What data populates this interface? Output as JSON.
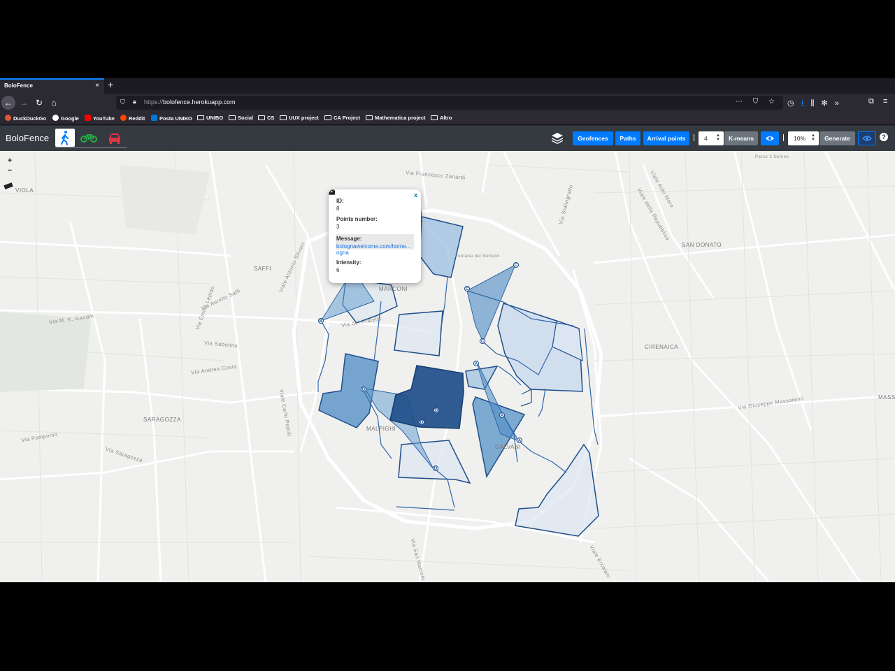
{
  "browser": {
    "tab_title": "BoloFence",
    "tab_close": "×",
    "new_tab": "+",
    "url_scheme": "https://",
    "url_host": "bolofence.herokuapp.com",
    "bookmarks": [
      "DuckDuckGo",
      "Google",
      "YouTube",
      "Reddit",
      "Posta UNIBO",
      "UNIBO",
      "Social",
      "CS",
      "UUX project",
      "CA Project",
      "Mathematica project",
      "Altro"
    ]
  },
  "app": {
    "brand": "BoloFence",
    "modes": [
      "walk-icon",
      "bike-icon",
      "car-icon"
    ],
    "buttons": {
      "geofences": "Geofences",
      "paths": "Paths",
      "arrival_points": "Arrival points",
      "kmeans": "K-means",
      "generate": "Generate",
      "help": "?"
    },
    "k_value": "4",
    "percent_value": "10%"
  },
  "map": {
    "zoom_in": "+",
    "zoom_out": "−",
    "labels": [
      "VIOLA",
      "SAFFI",
      "MARCONI",
      "SAN DONATO",
      "CIRENAICA",
      "SARAGOZZA",
      "MALPIGHI",
      "GALVANI",
      "MASS",
      "Via Andrea Costa",
      "Via Saragozza",
      "Via Sabotino",
      "Viale Carlo Pepoli",
      "Via Emilio Lepido",
      "Via Aurelio Saffi",
      "Via M. K. Gandhi",
      "Via Giuseppe Massarenti",
      "Via Pomponio",
      "Viale Antonio Silvani",
      "Parco 2 Donino",
      "Via San Mamolo",
      "Viale Ercolani",
      "Via Stalingrado",
      "Viale della Repubblica",
      "Via del Pratello",
      "Fontana dei Nettuno",
      "Viale Aldo Moro",
      "Via Francesco Zanardi"
    ],
    "colors": {
      "fence_dark": "#1f4e8a",
      "fence_mid": "#4c8bc4",
      "fence_light": "#c9daee",
      "path": "#2f66a8"
    },
    "markers": [
      "B",
      "C",
      "C",
      "C",
      "D",
      "D",
      "D",
      "D",
      "A",
      "A",
      "A"
    ]
  },
  "popup": {
    "close": "x",
    "id_label": "ID:",
    "id_value": "8",
    "points_label": "Points number:",
    "points_value": "3",
    "message_label": "Message:",
    "message_link_1": "bolognawelcome.com/home...",
    "message_link_2": "ogna",
    "intensity_label": "Intensity:",
    "intensity_value": "6"
  }
}
